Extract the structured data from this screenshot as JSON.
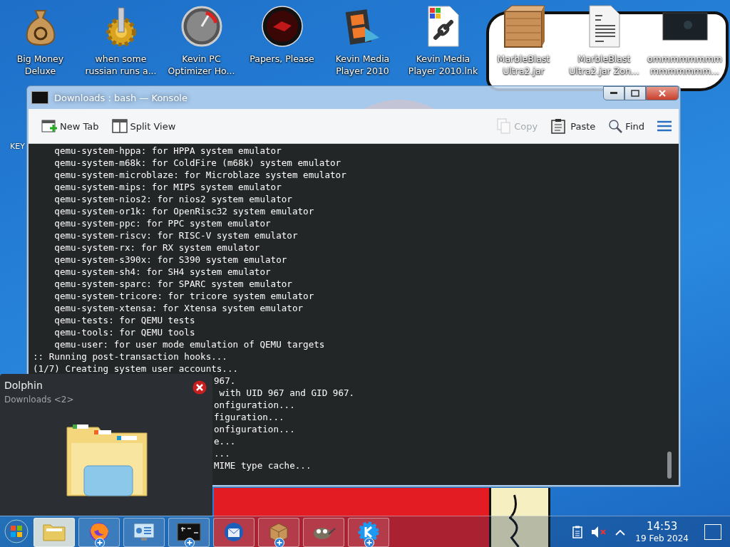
{
  "desktop": {
    "icons": [
      {
        "kind": "money-bag",
        "label": [
          "Big Money",
          "Deluxe"
        ]
      },
      {
        "kind": "gear",
        "label": [
          "when some",
          "russian runs a..."
        ]
      },
      {
        "kind": "gauge",
        "label": [
          "Kevin PC",
          "Optimizer Ho..."
        ]
      },
      {
        "kind": "red-disc",
        "label": [
          "Papers, Please"
        ]
      },
      {
        "kind": "film",
        "label": [
          "Kevin Media",
          "Player 2010"
        ]
      },
      {
        "kind": "shortcut",
        "label": [
          "Kevin Media",
          "Player 2010.lnk"
        ]
      },
      {
        "kind": "crate",
        "label": [
          "MarbleBlast",
          "Ultra2.jar"
        ]
      },
      {
        "kind": "document",
        "label": [
          "MarbleBlast",
          "Ultra2.jar Zon..."
        ]
      },
      {
        "kind": "thumbnail",
        "label": [
          "ommmmmmmm",
          "mmmmmmm..."
        ]
      }
    ],
    "hidden_label": "KEY"
  },
  "konsole": {
    "title": "Downloads : bash — Konsole",
    "toolbar_left": [
      {
        "kind": "new-tab",
        "label": "New Tab",
        "disabled": false
      },
      {
        "kind": "split-view",
        "label": "Split View",
        "disabled": false
      }
    ],
    "toolbar_right": [
      {
        "kind": "copy",
        "label": "Copy",
        "disabled": true
      },
      {
        "kind": "paste",
        "label": "Paste",
        "disabled": false
      },
      {
        "kind": "find",
        "label": "Find",
        "disabled": false
      },
      {
        "kind": "menu",
        "disabled": false
      }
    ],
    "lines": [
      {
        "kind": "full",
        "text": "    qemu-system-hppa: for HPPA system emulator"
      },
      {
        "kind": "full",
        "text": "    qemu-system-m68k: for ColdFire (m68k) system emulator"
      },
      {
        "kind": "full",
        "text": "    qemu-system-microblaze: for Microblaze system emulator"
      },
      {
        "kind": "full",
        "text": "    qemu-system-mips: for MIPS system emulator"
      },
      {
        "kind": "full",
        "text": "    qemu-system-nios2: for nios2 system emulator"
      },
      {
        "kind": "full",
        "text": "    qemu-system-or1k: for OpenRisc32 system emulator"
      },
      {
        "kind": "full",
        "text": "    qemu-system-ppc: for PPC system emulator"
      },
      {
        "kind": "full",
        "text": "    qemu-system-riscv: for RISC-V system emulator"
      },
      {
        "kind": "full",
        "text": "    qemu-system-rx: for RX system emulator"
      },
      {
        "kind": "full",
        "text": "    qemu-system-s390x: for S390 system emulator"
      },
      {
        "kind": "full",
        "text": "    qemu-system-sh4: for SH4 system emulator"
      },
      {
        "kind": "full",
        "text": "    qemu-system-sparc: for SPARC system emulator"
      },
      {
        "kind": "full",
        "text": "    qemu-system-tricore: for tricore system emulator"
      },
      {
        "kind": "full",
        "text": "    qemu-system-xtensa: for Xtensa system emulator"
      },
      {
        "kind": "full",
        "text": "    qemu-tests: for QEMU tests"
      },
      {
        "kind": "full",
        "text": "    qemu-tools: for QEMU tools"
      },
      {
        "kind": "full",
        "text": "    qemu-user: for user mode emulation of QEMU targets"
      },
      {
        "kind": "full",
        "text": ":: Running post-transaction hooks..."
      },
      {
        "kind": "full",
        "text": "(1/7) Creating system user accounts..."
      },
      {
        "kind": "partial",
        "text": "967."
      },
      {
        "kind": "partial",
        "text": " with UID 967 and GID 967."
      },
      {
        "kind": "partial",
        "text": "onfiguration..."
      },
      {
        "kind": "partial",
        "text": "figuration..."
      },
      {
        "kind": "partial",
        "text": "onfiguration..."
      },
      {
        "kind": "partial",
        "text": "e..."
      },
      {
        "kind": "partial",
        "text": "..."
      },
      {
        "kind": "partial",
        "text": "MIME type cache..."
      }
    ]
  },
  "popup": {
    "title": "Dolphin",
    "subtitle": "Downloads <2>"
  },
  "taskbar": {
    "items": [
      {
        "kind": "folder",
        "selected": true,
        "badge": false
      },
      {
        "kind": "firefox",
        "selected": false,
        "badge": true
      },
      {
        "kind": "remote",
        "selected": false,
        "badge": false
      },
      {
        "kind": "terminal",
        "selected": false,
        "badge": true
      },
      {
        "kind": "thunderbird",
        "selected": false,
        "badge": false
      },
      {
        "kind": "package",
        "selected": false,
        "badge": true
      },
      {
        "kind": "gimp",
        "selected": false,
        "badge": false
      },
      {
        "kind": "kde",
        "selected": false,
        "badge": true
      }
    ],
    "clock": {
      "time": "14:53",
      "date": "19 Feb 2024"
    }
  }
}
